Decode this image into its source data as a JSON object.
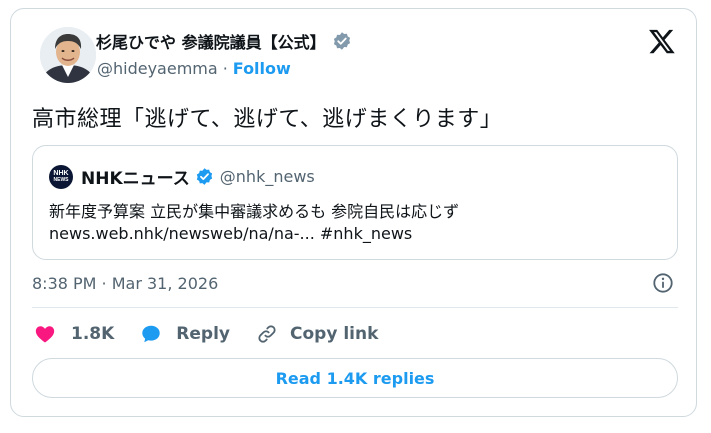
{
  "author": {
    "name": "杉尾ひでや 参議院議員【公式】",
    "handle": "@hideyaemma",
    "separator": "·",
    "follow_label": "Follow"
  },
  "tweet": {
    "text": "高市総理「逃げて、逃げて、逃げまくります」",
    "timestamp": "8:38 PM · Mar 31, 2026"
  },
  "quote": {
    "name": "NHKニュース",
    "handle": "@nhk_news",
    "logo_text_top": "NHK",
    "logo_text_bottom": "NEWS",
    "line1": "新年度予算案 立民が集中審議求めるも 参院自民は応じず",
    "line2": "news.web.nhk/newsweb/na/na-... #nhk_news"
  },
  "actions": {
    "likes": "1.8K",
    "reply_label": "Reply",
    "copy_link_label": "Copy link"
  },
  "read_replies_label": "Read 1.4K replies",
  "colors": {
    "accent": "#1d9bf0",
    "like": "#f91880",
    "text": "#0f1419",
    "muted": "#536471",
    "border": "#cfd9de"
  },
  "icons": [
    "x-logo-icon",
    "verified-badge-icon",
    "heart-icon",
    "reply-bubble-icon",
    "link-icon",
    "info-icon"
  ]
}
